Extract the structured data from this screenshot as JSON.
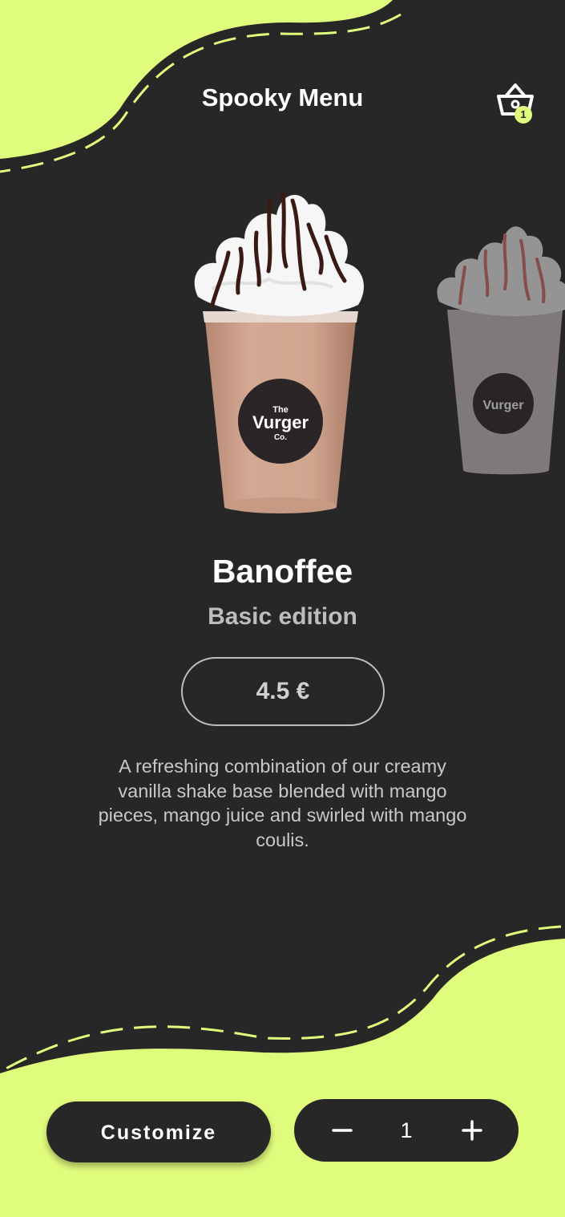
{
  "header": {
    "title": "Spooky Menu",
    "basket_count": "1"
  },
  "product": {
    "name": "Banoffee",
    "edition": "Basic edition",
    "price": "4.5 €",
    "description": "A refreshing combination of our creamy vanilla shake base blended with mango pieces, mango juice and swirled with mango coulis.",
    "cup_text": {
      "brand_top": "The",
      "brand_main": "Vurger",
      "brand_sub": "Co."
    }
  },
  "actions": {
    "customize_label": "Customize",
    "quantity": "1"
  },
  "colors": {
    "background": "#272727",
    "accent": "#e0fc7c",
    "text_primary": "#ffffff",
    "text_secondary": "#bdbdbd"
  },
  "icons": {
    "basket": "basket-icon",
    "minus": "minus-icon",
    "plus": "plus-icon"
  }
}
